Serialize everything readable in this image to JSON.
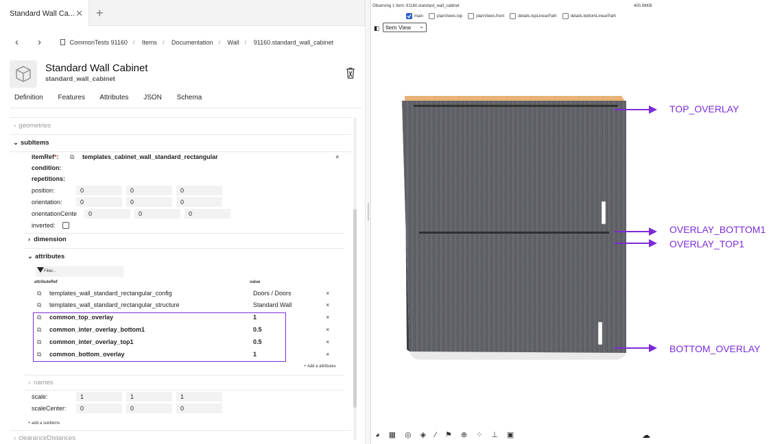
{
  "tab": {
    "title": "Standard Wall Ca...",
    "close": "✕",
    "new": "+"
  },
  "nav": {
    "back": "‹",
    "forward": "›"
  },
  "breadcrumb": [
    "CommonTests 91160",
    "Items",
    "Documentation",
    "Wall",
    "91160.standard_wall_cabinet"
  ],
  "item": {
    "title": "Standard Wall Cabinet",
    "subtitle": "standard_wall_cabinet"
  },
  "tabs": [
    "Definition",
    "Features",
    "Attributes",
    "JSON",
    "Schema"
  ],
  "sections": {
    "geometries": "geometries",
    "subitems": "subItems",
    "dimension": "dimension",
    "attributes": "attributes",
    "names": "names",
    "clearance": "clearanceDistances"
  },
  "subitem": {
    "itemref_label": "itemRef",
    "itemref_req": "*",
    "itemref_colon": ":",
    "itemref_value": "templates_cabinet_wall_standard_rectangular",
    "condition": "condition:",
    "repetitions": "repetitions:",
    "position_label": "position:",
    "position": [
      "0",
      "0",
      "0"
    ],
    "orientation_label": "orientation:",
    "orientation": [
      "0",
      "0",
      "0"
    ],
    "orientation_center_label": "orientationCente",
    "orientation_center": [
      "0",
      "0",
      "0"
    ],
    "inverted_label": "inverted:",
    "scale_label": "scale:",
    "scale": [
      "1",
      "1",
      "1"
    ],
    "scale_center_label": "scaleCenter:",
    "scale_center": [
      "0",
      "0",
      "0"
    ]
  },
  "attributes": {
    "filter_placeholder": "Filter...",
    "col_ref": "attributeRef",
    "col_value": "value",
    "rows": [
      {
        "ref": "templates_wall_standard_rectangular_config",
        "value": "Doors / Doors",
        "bold": false
      },
      {
        "ref": "templates_wall_standard_rectangular_structure",
        "value": "Standard Wall",
        "bold": false
      },
      {
        "ref": "common_top_overlay",
        "value": "1",
        "bold": true
      },
      {
        "ref": "common_inter_overlay_bottom1",
        "value": "0.5",
        "bold": true
      },
      {
        "ref": "common_inter_overlay_top1",
        "value": "0.5",
        "bold": true
      },
      {
        "ref": "common_bottom_overlay",
        "value": "1",
        "bold": true
      }
    ],
    "add": "+ Add a attributes"
  },
  "add_subitems": "+ add a subItems",
  "viewer": {
    "status": "Observing 1 Item: 91160.standard_wall_cabinet",
    "size": "400.99KB",
    "checks": [
      {
        "label": "main",
        "checked": true
      },
      {
        "label": "planViews.top",
        "checked": false
      },
      {
        "label": "planViews.front",
        "checked": false
      },
      {
        "label": "details.topLinearPath",
        "checked": false
      },
      {
        "label": "details.bottomLinearPath",
        "checked": false
      }
    ],
    "view_select": "Item View"
  },
  "annotations": [
    "TOP_OVERLAY",
    "OVERLAY_BOTTOM1",
    "OVERLAY_TOP1",
    "BOTTOM_OVERLAY"
  ],
  "colors": {
    "annotation": "#7c2bd8",
    "cabinet": "#5f6066",
    "countertop": "#e8b276"
  }
}
